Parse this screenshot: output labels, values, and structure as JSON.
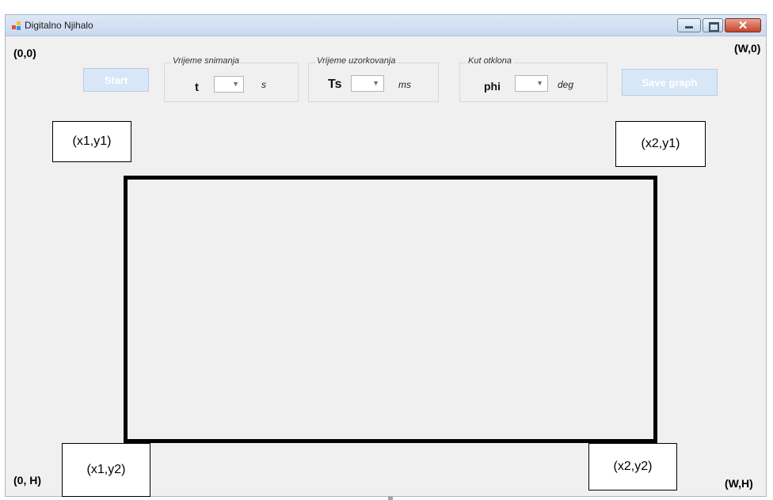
{
  "window": {
    "title": "Digitalno Njihalo"
  },
  "corners": {
    "top_left": "(0,0)",
    "top_right": "(W,0)",
    "bottom_left": "(0, H)",
    "bottom_right": "(W,H)"
  },
  "toolbar": {
    "start_label": "Start",
    "save_label": "Save graph"
  },
  "groups": {
    "recording_time": {
      "title": "Vrijeme snimanja",
      "variable": "t",
      "unit": "s",
      "value": ""
    },
    "sampling_time": {
      "title": "Vrijeme uzorkovanja",
      "variable": "Ts",
      "unit": "ms",
      "value": ""
    },
    "deflection_angle": {
      "title": "Kut otklona",
      "variable": "phi",
      "unit": "deg",
      "value": ""
    }
  },
  "canvas_labels": {
    "top_left": "(x1,y1)",
    "top_right": "(x2,y1)",
    "bottom_left": "(x1,y2)",
    "bottom_right": "(x2,y2)"
  },
  "colors": {
    "button_disabled_bg": "#d7e7f8",
    "close_button": "#c3452c",
    "window_bg": "#f0f0f0"
  },
  "icons": [
    "app-icon",
    "minimize-icon",
    "maximize-icon",
    "close-icon",
    "chevron-down-icon"
  ]
}
